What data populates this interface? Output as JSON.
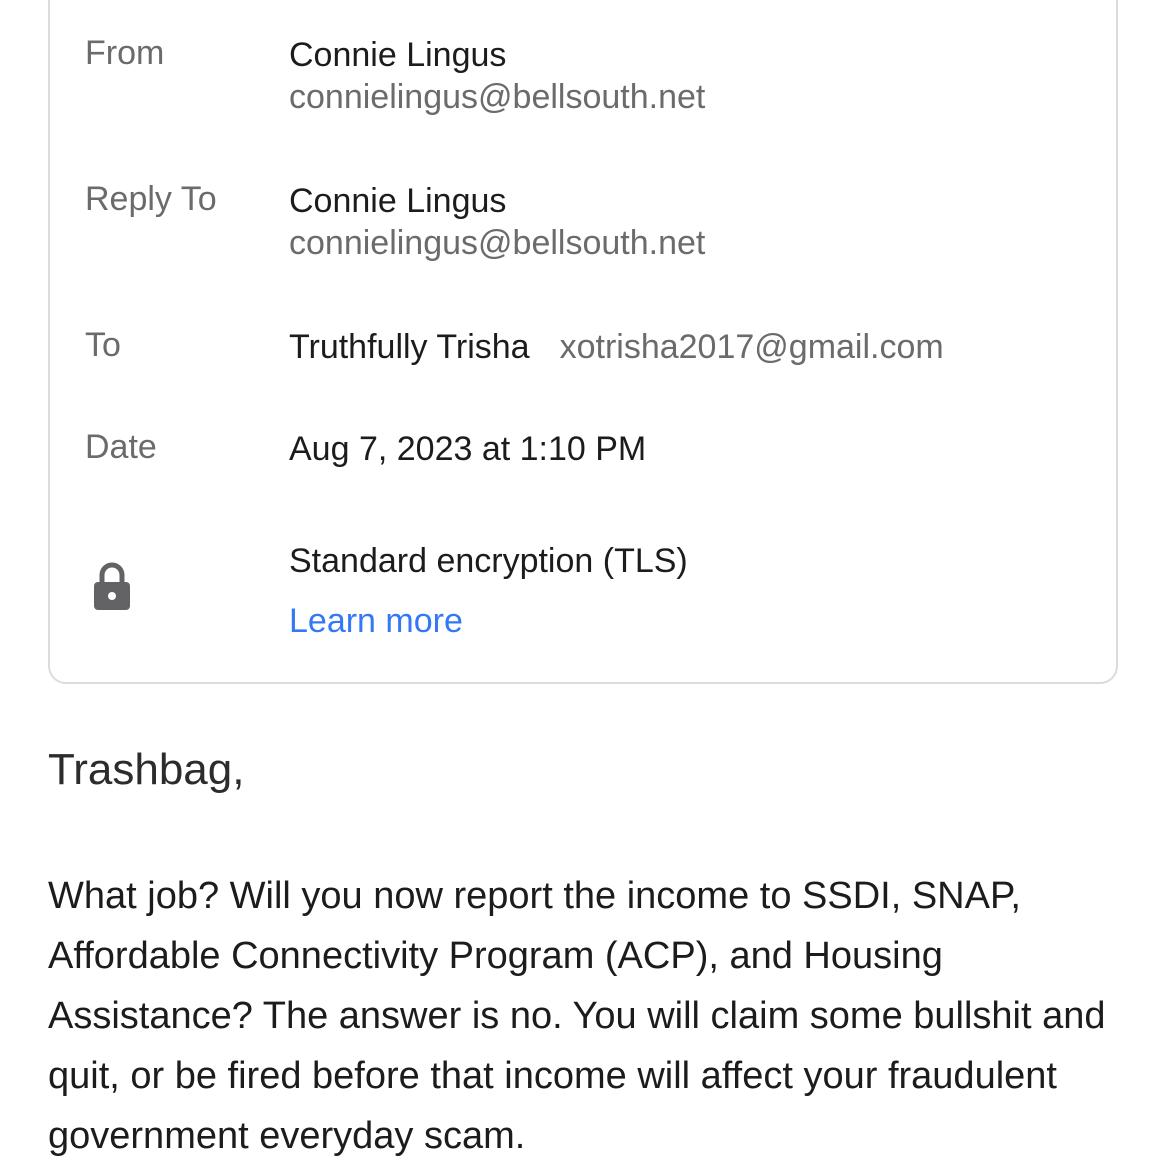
{
  "header": {
    "from": {
      "label": "From",
      "name": "Connie Lingus",
      "email": "connielingus@bellsouth.net"
    },
    "reply_to": {
      "label": "Reply To",
      "name": "Connie Lingus",
      "email": "connielingus@bellsouth.net"
    },
    "to": {
      "label": "To",
      "name": "Truthfully Trisha",
      "email": "xotrisha2017@gmail.com"
    },
    "date": {
      "label": "Date",
      "value": "Aug 7, 2023 at 1:10 PM"
    },
    "security": {
      "icon": "lock-icon",
      "text": "Standard encryption (TLS)",
      "link": "Learn more"
    }
  },
  "message": {
    "greeting": "Trashbag,",
    "body": "What job? Will you now report the income to SSDI, SNAP, Affordable Connectivity Program (ACP), and Housing Assistance? The answer is no. You will claim some bullshit and quit, or be fired before that income will affect your fraudulent government everyday scam."
  },
  "colors": {
    "link": "#3478f6",
    "secondary_text": "#6b6b6b",
    "border": "#dcdcdc"
  }
}
